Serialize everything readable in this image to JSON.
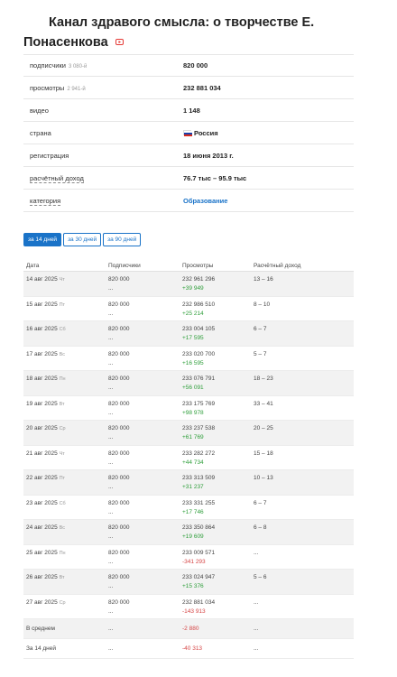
{
  "channel": {
    "title_line1": "Канал здравого смысла: о творчестве Е.",
    "title_line2": "Понасенкова"
  },
  "info": {
    "subscribers_label": "подписчики",
    "subscribers_rank": "3 080-й",
    "subscribers_value": "820 000",
    "views_label": "просмотры",
    "views_rank": "2 941-й",
    "views_value": "232 881 034",
    "videos_label": "видео",
    "videos_value": "1 148",
    "country_label": "страна",
    "country_value": "Россия",
    "registration_label": "регистрация",
    "registration_value": "18 июня 2013 г.",
    "income_label": "расчётный доход",
    "income_value": "76.7 тыс – 95.9 тыс",
    "category_label": "категория",
    "category_value": "Образование"
  },
  "tabs": [
    "за 14 дней",
    "за 30 дней",
    "за 90 дней"
  ],
  "table": {
    "headers": [
      "Дата",
      "Подписчики",
      "Просмотры",
      "Расчётный доход"
    ],
    "rows": [
      {
        "date": "14 авг 2025",
        "dow": "Чт",
        "subs": "820 000",
        "subs_delta": "...",
        "views": "232 961 296",
        "views_delta": "+39 949",
        "delta_sign": "pos",
        "income": "13 – 16"
      },
      {
        "date": "15 авг 2025",
        "dow": "Пт",
        "subs": "820 000",
        "subs_delta": "...",
        "views": "232 986 510",
        "views_delta": "+25 214",
        "delta_sign": "pos",
        "income": "8 – 10"
      },
      {
        "date": "16 авг 2025",
        "dow": "Сб",
        "subs": "820 000",
        "subs_delta": "...",
        "views": "233 004 105",
        "views_delta": "+17 595",
        "delta_sign": "pos",
        "income": "6 – 7"
      },
      {
        "date": "17 авг 2025",
        "dow": "Вс",
        "subs": "820 000",
        "subs_delta": "...",
        "views": "233 020 700",
        "views_delta": "+16 595",
        "delta_sign": "pos",
        "income": "5 – 7"
      },
      {
        "date": "18 авг 2025",
        "dow": "Пн",
        "subs": "820 000",
        "subs_delta": "...",
        "views": "233 076 791",
        "views_delta": "+56 091",
        "delta_sign": "pos",
        "income": "18 – 23"
      },
      {
        "date": "19 авг 2025",
        "dow": "Вт",
        "subs": "820 000",
        "subs_delta": "...",
        "views": "233 175 769",
        "views_delta": "+98 978",
        "delta_sign": "pos",
        "income": "33 – 41"
      },
      {
        "date": "20 авг 2025",
        "dow": "Ср",
        "subs": "820 000",
        "subs_delta": "...",
        "views": "233 237 538",
        "views_delta": "+61 769",
        "delta_sign": "pos",
        "income": "20 – 25"
      },
      {
        "date": "21 авг 2025",
        "dow": "Чт",
        "subs": "820 000",
        "subs_delta": "...",
        "views": "233 282 272",
        "views_delta": "+44 734",
        "delta_sign": "pos",
        "income": "15 – 18"
      },
      {
        "date": "22 авг 2025",
        "dow": "Пт",
        "subs": "820 000",
        "subs_delta": "...",
        "views": "233 313 509",
        "views_delta": "+31 237",
        "delta_sign": "pos",
        "income": "10 – 13"
      },
      {
        "date": "23 авг 2025",
        "dow": "Сб",
        "subs": "820 000",
        "subs_delta": "...",
        "views": "233 331 255",
        "views_delta": "+17 746",
        "delta_sign": "pos",
        "income": "6 – 7"
      },
      {
        "date": "24 авг 2025",
        "dow": "Вс",
        "subs": "820 000",
        "subs_delta": "...",
        "views": "233 350 864",
        "views_delta": "+19 609",
        "delta_sign": "pos",
        "income": "6 – 8"
      },
      {
        "date": "25 авг 2025",
        "dow": "Пн",
        "subs": "820 000",
        "subs_delta": "...",
        "views": "233 009 571",
        "views_delta": "-341 293",
        "delta_sign": "neg",
        "income": "..."
      },
      {
        "date": "26 авг 2025",
        "dow": "Вт",
        "subs": "820 000",
        "subs_delta": "...",
        "views": "233 024 947",
        "views_delta": "+15 376",
        "delta_sign": "pos",
        "income": "5 – 6"
      },
      {
        "date": "27 авг 2025",
        "dow": "Ср",
        "subs": "820 000",
        "subs_delta": "...",
        "views": "232 881 034",
        "views_delta": "-143 913",
        "delta_sign": "neg",
        "income": "..."
      }
    ],
    "footer": [
      {
        "label": "В среднем",
        "subs": "...",
        "views": "-2 880",
        "income": "..."
      },
      {
        "label": "За 14 дней",
        "subs": "...",
        "views": "-40 313",
        "income": "..."
      }
    ]
  },
  "colors": {
    "accent": "#1a73c8",
    "positive": "#2e9e3a",
    "negative": "#d64545"
  },
  "icons": {
    "youtube": "youtube-icon",
    "flag": "russia-flag-icon"
  }
}
